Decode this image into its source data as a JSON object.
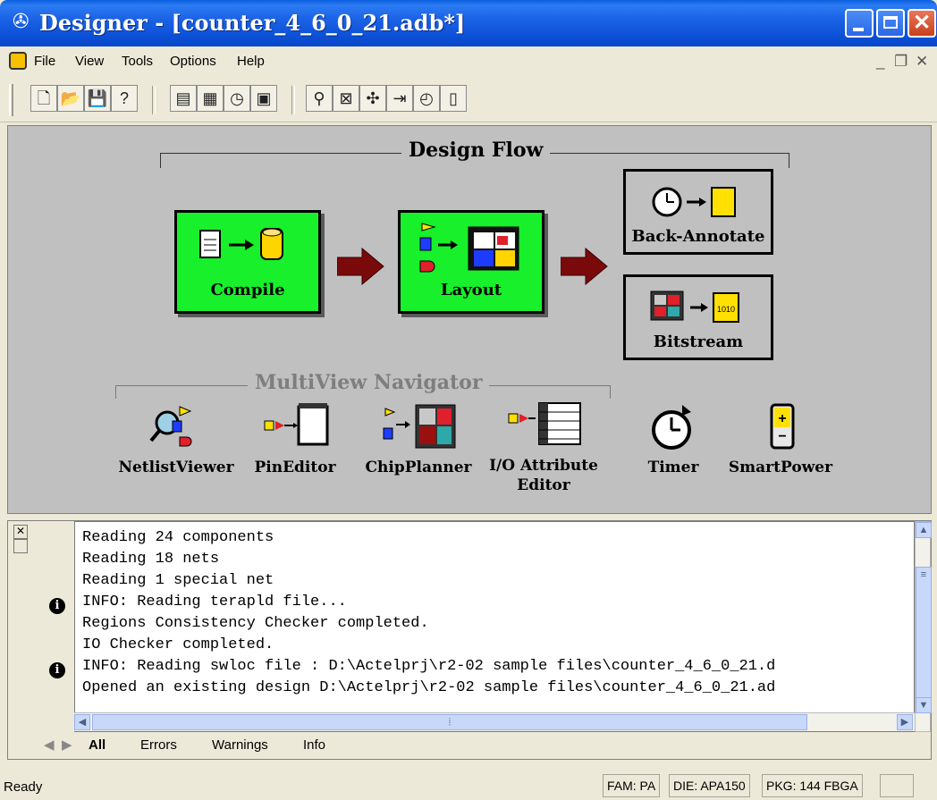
{
  "window": {
    "title": "Designer - [counter_4_6_0_21.adb*]",
    "app_icon": "designer-app-icon"
  },
  "menu": {
    "items": [
      "File",
      "View",
      "Tools",
      "Options",
      "Help"
    ]
  },
  "toolbar": {
    "buttons": [
      "new-icon",
      "open-icon",
      "save-icon",
      "help-icon",
      "compile-icon",
      "layout-icon",
      "timer-tool-icon",
      "bitstream-icon",
      "netlist-viewer-icon",
      "pin-editor-icon",
      "chip-planner-icon",
      "io-attribute-icon",
      "timer-icon",
      "smartpower-icon"
    ]
  },
  "design_flow": {
    "title": "Design Flow",
    "compile_label": "Compile",
    "layout_label": "Layout",
    "back_annotate_label": "Back-Annotate",
    "bitstream_label": "Bitstream",
    "bitstream_glyph": "1010"
  },
  "navigator": {
    "title": "MultiView Navigator",
    "tools": [
      "NetlistViewer",
      "PinEditor",
      "ChipPlanner",
      "I/O Attribute",
      "Editor"
    ],
    "timer_label": "Timer",
    "smartpower_label": "SmartPower"
  },
  "log": {
    "lines": [
      "Reading 24 components",
      "Reading 18 nets",
      "Reading 1 special net",
      "INFO: Reading terapld file...",
      "Regions Consistency Checker completed.",
      "IO Checker completed.",
      "INFO: Reading swloc file : D:\\Actelprj\\r2-02 sample files\\counter_4_6_0_21.d",
      "Opened an existing design D:\\Actelprj\\r2-02 sample files\\counter_4_6_0_21.ad"
    ],
    "tabs": [
      "All",
      "Errors",
      "Warnings",
      "Info"
    ],
    "active_tab": "All"
  },
  "status": {
    "text": "Ready",
    "fam": "FAM: PA",
    "die": "DIE: APA150",
    "pkg": "PKG: 144 FBGA"
  },
  "colors": {
    "accent": "#17f02a",
    "arrow": "#7a0a0a",
    "titlebar": "#0b4fd6"
  }
}
